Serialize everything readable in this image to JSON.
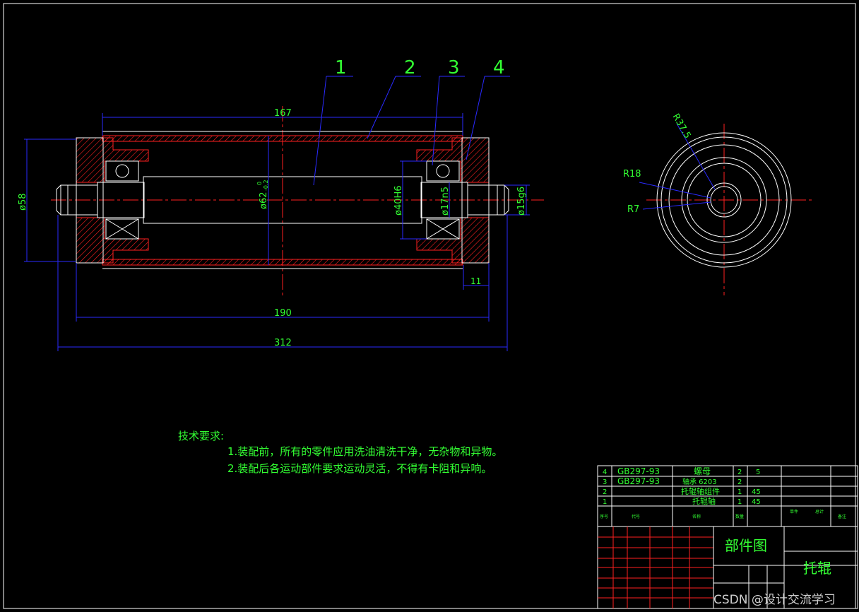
{
  "drawing": {
    "callouts": [
      "1",
      "2",
      "3",
      "4"
    ],
    "dimensions": {
      "d167": "167",
      "d190": "190",
      "d312": "312",
      "d11": "11",
      "phi58": "ø58",
      "phi62": "ø62",
      "phi62_tol_upper": "0",
      "phi62_tol_lower": "-0.2",
      "phi40": "ø40H6",
      "phi17": "ø17n5",
      "phi15": "ø15g6",
      "r375": "R37.5",
      "r18": "R18",
      "r7": "R7"
    }
  },
  "technical_requirements": {
    "title": "技术要求:",
    "items": [
      "1.装配前，所有的零件应用洗油清洗干净，无杂物和异物。",
      "2.装配后各运动部件要求运动灵活，不得有卡阻和异响。"
    ]
  },
  "bom": {
    "rows": [
      {
        "no": "4",
        "code": "GB297-93",
        "name": "螺母",
        "qty": "2",
        "material": "5"
      },
      {
        "no": "3",
        "code": "GB297-93",
        "name": "轴承 6203",
        "qty": "2",
        "material": ""
      },
      {
        "no": "2",
        "code": "",
        "name": "托辊轴组件",
        "qty": "1",
        "material": "45"
      },
      {
        "no": "1",
        "code": "",
        "name": "托辊轴",
        "qty": "1",
        "material": "45"
      }
    ]
  },
  "title_block": {
    "drawing_type": "部件图",
    "part_name": "托辊",
    "header_labels": [
      "序号",
      "代号",
      "名称",
      "数量",
      "单件",
      "总计",
      "备注"
    ]
  },
  "watermark": "CSDN @设计交流学习",
  "colors": {
    "background": "#000000",
    "outline": "#ffffff",
    "section_hatch": "#ff2020",
    "dimension": "#2a2aff",
    "text": "#33ff33",
    "centerline": "#ff2020"
  }
}
